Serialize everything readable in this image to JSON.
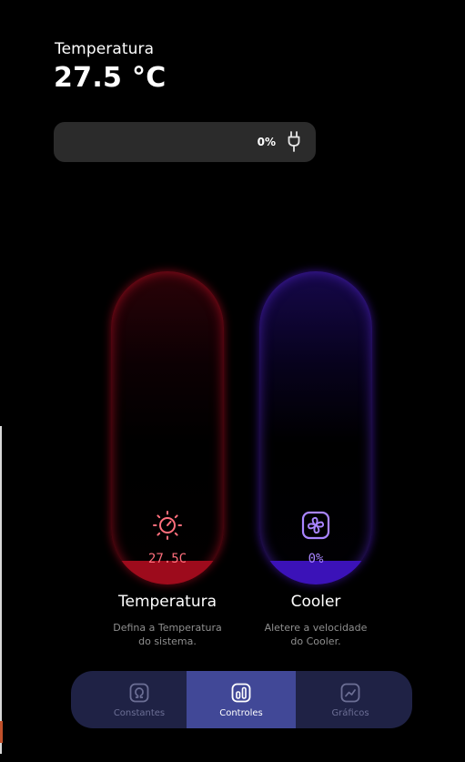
{
  "header": {
    "label": "Temperatura",
    "value": "27.5 °C"
  },
  "power": {
    "value_text": "0%",
    "level_percent": 0,
    "icon": "plug-icon"
  },
  "controls": [
    {
      "id": "temperatura",
      "reading": "27.5C",
      "title": "Temperatura",
      "description_line1": "Defina a Temperatura",
      "description_line2": "do sistema.",
      "icon": "sun-gauge-icon",
      "color": "#e0102e"
    },
    {
      "id": "cooler",
      "reading": "0%",
      "title": "Cooler",
      "description_line1": "Aletere a velocidade",
      "description_line2": "do Cooler.",
      "icon": "fan-icon",
      "color": "#4b1fe0"
    }
  ],
  "nav": {
    "tabs": [
      {
        "label": "Constantes",
        "icon": "omega-icon",
        "active": false
      },
      {
        "label": "Controles",
        "icon": "bar-chart-icon",
        "active": true
      },
      {
        "label": "Gráficos",
        "icon": "line-chart-icon",
        "active": false
      }
    ],
    "background": "#1f2245",
    "active_color": "#414897"
  }
}
